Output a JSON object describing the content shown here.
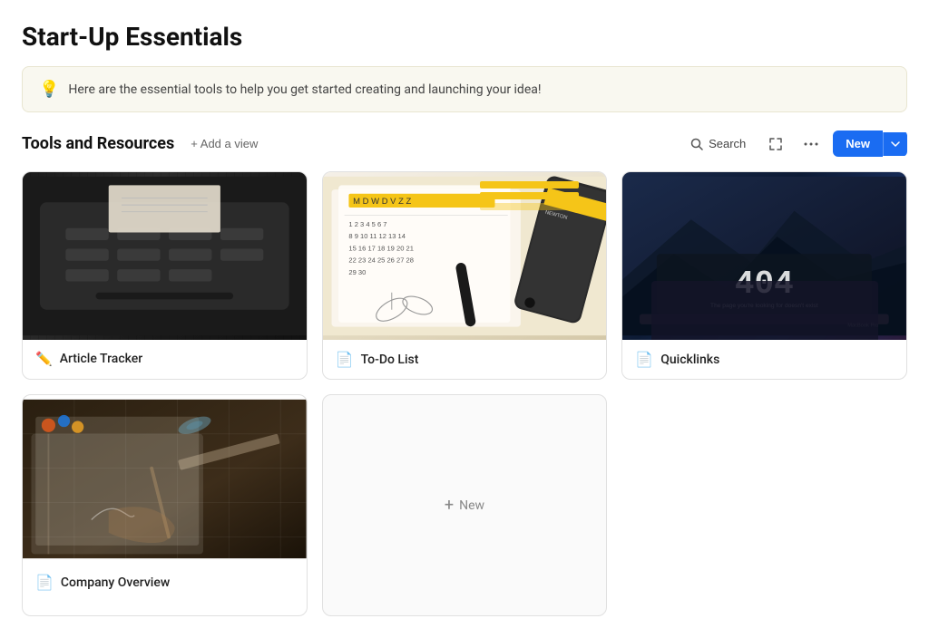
{
  "page": {
    "title": "Start-Up Essentials",
    "banner": {
      "icon": "💡",
      "text": "Here are the essential tools to help you get started creating and launching your idea!"
    }
  },
  "toolbar": {
    "section_title": "Tools and Resources",
    "add_view_label": "+ Add a view",
    "search_label": "Search",
    "new_label": "New"
  },
  "cards": [
    {
      "id": "article-tracker",
      "title": "Article Tracker",
      "icon": "✏️",
      "type": "pencil",
      "image_type": "typewriter"
    },
    {
      "id": "to-do-list",
      "title": "To-Do List",
      "icon": "📄",
      "type": "doc",
      "image_type": "calendar"
    },
    {
      "id": "quicklinks",
      "title": "Quicklinks",
      "icon": "📄",
      "type": "doc",
      "image_type": "laptop"
    },
    {
      "id": "company-overview",
      "title": "Company Overview",
      "icon": "📄",
      "type": "doc",
      "image_type": "blueprint"
    }
  ],
  "new_card": {
    "plus": "+",
    "label": "New"
  }
}
